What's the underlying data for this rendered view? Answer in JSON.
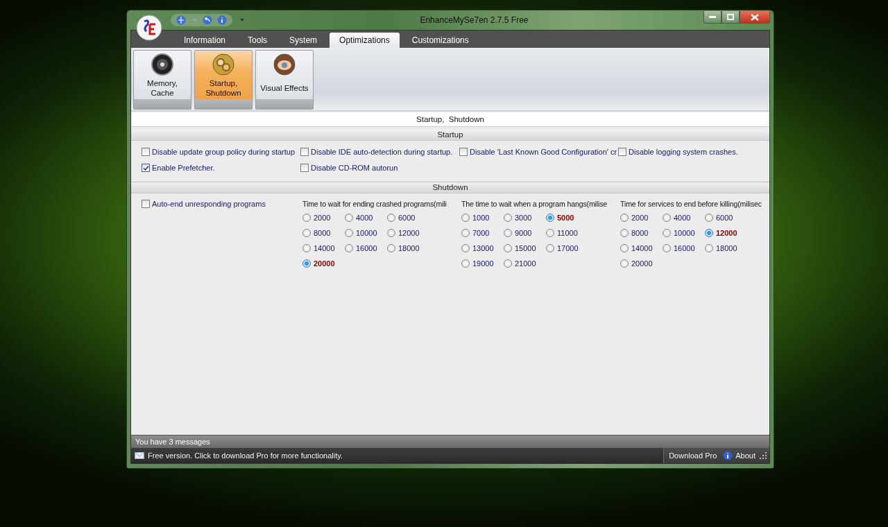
{
  "window": {
    "title": "EnhanceMySe7en 2.7.5 Free"
  },
  "tabs": [
    {
      "label": "Information",
      "selected": false
    },
    {
      "label": "Tools",
      "selected": false
    },
    {
      "label": "System",
      "selected": false
    },
    {
      "label": "Optimizations",
      "selected": true
    },
    {
      "label": "Customizations",
      "selected": false
    }
  ],
  "ribbon": {
    "buttons": [
      {
        "label": "Memory,\nCache",
        "kind": "memory",
        "selected": false
      },
      {
        "label": "Startup,\nShutdown",
        "kind": "startup",
        "selected": true
      },
      {
        "label": "Visual Effects",
        "kind": "visual",
        "selected": false
      }
    ]
  },
  "page_title": "Startup,  Shutdown",
  "startup": {
    "title": "Startup",
    "options": [
      {
        "label": "Disable update group policy during startup",
        "checked": false
      },
      {
        "label": "Disable IDE auto-detection during startup.",
        "checked": false
      },
      {
        "label": "Disable 'Last Known Good Configuration' cr",
        "checked": false
      },
      {
        "label": "Disable logging system crashes.",
        "checked": false
      },
      {
        "label": "Enable Prefetcher.",
        "checked": true
      },
      {
        "label": "Disable CD-ROM autorun",
        "checked": false
      }
    ]
  },
  "shutdown": {
    "title": "Shutdown",
    "options": [
      {
        "label": "Auto-end unresponding programs",
        "checked": false
      }
    ],
    "groups": [
      {
        "heading": "Time to wait for ending crashed programs(mili",
        "options": [
          {
            "label": "2000",
            "selected": false
          },
          {
            "label": "4000",
            "selected": false
          },
          {
            "label": "6000",
            "selected": false
          },
          {
            "label": "8000",
            "selected": false
          },
          {
            "label": "10000",
            "selected": false
          },
          {
            "label": "12000",
            "selected": false
          },
          {
            "label": "14000",
            "selected": false
          },
          {
            "label": "16000",
            "selected": false
          },
          {
            "label": "18000",
            "selected": false
          },
          {
            "label": "20000",
            "selected": true
          }
        ]
      },
      {
        "heading": "The time to wait when a program hangs(milise",
        "options": [
          {
            "label": "1000",
            "selected": false
          },
          {
            "label": "3000",
            "selected": false
          },
          {
            "label": "5000",
            "selected": true
          },
          {
            "label": "7000",
            "selected": false
          },
          {
            "label": "9000",
            "selected": false
          },
          {
            "label": "11000",
            "selected": false
          },
          {
            "label": "13000",
            "selected": false
          },
          {
            "label": "15000",
            "selected": false
          },
          {
            "label": "17000",
            "selected": false
          },
          {
            "label": "19000",
            "selected": false
          },
          {
            "label": "21000",
            "selected": false
          }
        ]
      },
      {
        "heading": "Time for services to end before killing(milisec",
        "options": [
          {
            "label": "2000",
            "selected": false
          },
          {
            "label": "4000",
            "selected": false
          },
          {
            "label": "6000",
            "selected": false
          },
          {
            "label": "8000",
            "selected": false
          },
          {
            "label": "10000",
            "selected": false
          },
          {
            "label": "12000",
            "selected": true
          },
          {
            "label": "14000",
            "selected": false
          },
          {
            "label": "16000",
            "selected": false
          },
          {
            "label": "18000",
            "selected": false
          },
          {
            "label": "20000",
            "selected": false
          }
        ]
      }
    ]
  },
  "messages": "You have 3 messages",
  "status_bar": {
    "text": "Free version. Click to download Pro for more functionality.",
    "buttons": [
      "Download Pro",
      "About"
    ]
  }
}
